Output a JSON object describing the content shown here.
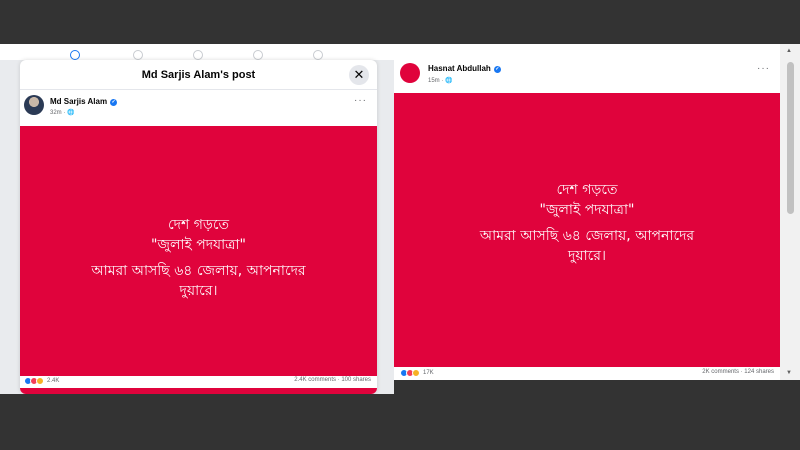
{
  "left": {
    "modal_title": "Md Sarjis Alam's post",
    "close_label": "✕",
    "author": "Md Sarjis Alam",
    "time": "32m · 🌐",
    "more": "···",
    "lines": [
      "দেশ গড়তে",
      "\"জুলাই পদযাত্রা\"",
      "আমরা আসছি ৬৪ জেলায়, আপনাদের",
      "দুয়ারে।"
    ],
    "reaction_count": "2.4K",
    "comments_shares": "2.4K comments · 100 shares"
  },
  "right": {
    "author": "Hasnat Abdullah",
    "time": "15m · 🌐",
    "more": "···",
    "lines": [
      "দেশ গড়তে",
      "\"জুলাই পদযাত্রা\"",
      "আমরা আসছি ৬৪ জেলায়, আপনাদের",
      "দুয়ারে।"
    ],
    "reaction_count": "17K",
    "comments_shares": "2K comments · 124 shares"
  },
  "colors": {
    "post_bg": "#e0033c",
    "verified": "#1877f2",
    "background": "#333333"
  }
}
